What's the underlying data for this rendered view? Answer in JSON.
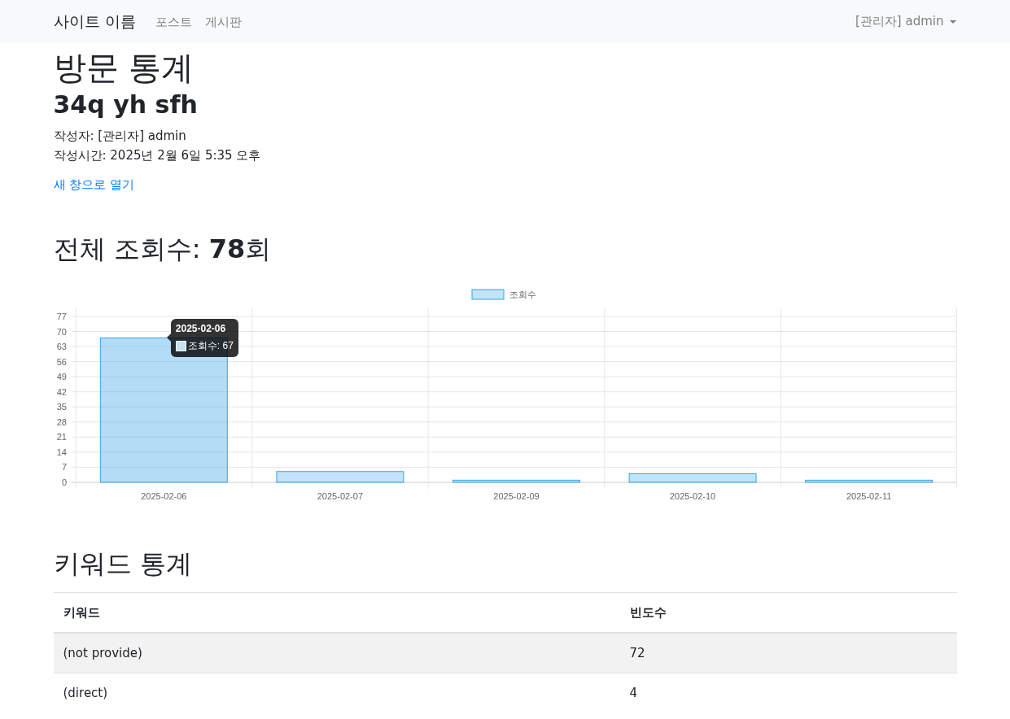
{
  "navbar": {
    "brand": "사이트 이름",
    "links": [
      {
        "label": "포스트"
      },
      {
        "label": "게시판"
      }
    ],
    "user_menu": "[관리자] admin"
  },
  "page_title": "방문 통계",
  "post": {
    "title": "34q yh sfh",
    "author": "작성자: [관리자] admin",
    "time": "작성시간: 2025년 2월 6일 5:35 오후",
    "open_link": "새 창으로 열기"
  },
  "views_heading": "전체 조회수: **78**회",
  "chart": {
    "chart_data": {
      "type": "bar",
      "categories": [
        "2025-02-06",
        "2025-02-07",
        "2025-02-09",
        "2025-02-10",
        "2025-02-11"
      ],
      "series": [
        {
          "name": "조회수",
          "color": "#36a2eb",
          "values": [
            67,
            5,
            1,
            4,
            1
          ]
        }
      ],
      "grid": true,
      "ylim": [
        0,
        77
      ],
      "yticks": [
        0,
        7,
        14,
        21,
        28,
        35,
        42,
        49,
        56,
        63,
        70,
        77
      ]
    },
    "tooltip": {
      "title": "2025-02-06",
      "label": "조회수: 67"
    }
  },
  "keywords": {
    "heading": "키워드 통계",
    "columns": [
      "키워드",
      "빈도수"
    ],
    "rows": [
      [
        "(not provide)",
        "72"
      ],
      [
        "(direct)",
        "4"
      ]
    ]
  }
}
